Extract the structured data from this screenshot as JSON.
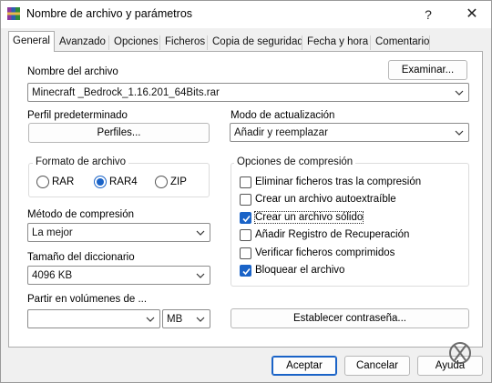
{
  "window": {
    "title": "Nombre de archivo y parámetros",
    "help": "?",
    "close": "✕"
  },
  "tabs": [
    {
      "label": "General"
    },
    {
      "label": "Avanzado"
    },
    {
      "label": "Opciones"
    },
    {
      "label": "Ficheros"
    },
    {
      "label": "Copia de seguridad"
    },
    {
      "label": "Fecha y hora"
    },
    {
      "label": "Comentario"
    }
  ],
  "archive": {
    "label": "Nombre del archivo",
    "browse_button": "Examinar...",
    "filename": "Minecraft _Bedrock_1.16.201_64Bits.rar"
  },
  "profile": {
    "label": "Perfil predeterminado",
    "button": "Perfiles..."
  },
  "update_mode": {
    "label": "Modo de actualización",
    "value": "Añadir y reemplazar"
  },
  "format": {
    "title": "Formato de archivo",
    "options": [
      {
        "label": "RAR",
        "selected": false
      },
      {
        "label": "RAR4",
        "selected": true
      },
      {
        "label": "ZIP",
        "selected": false
      }
    ]
  },
  "compression_method": {
    "label": "Método de compresión",
    "value": "La mejor"
  },
  "dictionary": {
    "label": "Tamaño del diccionario",
    "value": "4096 KB"
  },
  "split": {
    "label": "Partir en volúmenes de ...",
    "value": "",
    "unit": "MB"
  },
  "compression_options": {
    "title": "Opciones de compresión",
    "items": [
      {
        "label": "Eliminar ficheros tras la compresión",
        "checked": false
      },
      {
        "label": "Crear un archivo autoextraíble",
        "checked": false
      },
      {
        "label": "Crear un archivo sólido",
        "checked": true
      },
      {
        "label": "Añadir Registro de Recuperación",
        "checked": false
      },
      {
        "label": "Verificar ficheros comprimidos",
        "checked": false
      },
      {
        "label": "Bloquear el archivo",
        "checked": true
      }
    ]
  },
  "password_button": "Establecer contraseña...",
  "footer": {
    "ok": "Aceptar",
    "cancel": "Cancelar",
    "help": "Ayuda"
  },
  "watermark": "SOLVETIC",
  "colors": {
    "accent": "#1a63c7"
  }
}
